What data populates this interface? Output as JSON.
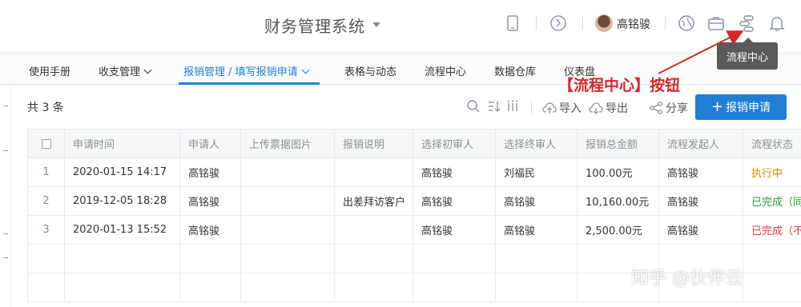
{
  "header": {
    "app_title": "财务管理系统",
    "username": "高铭骏"
  },
  "nav": {
    "items": [
      "使用手册",
      "收支管理",
      "报销管理 / 填写报销申请",
      "表格与动态",
      "流程中心",
      "数据仓库",
      "仪表盘"
    ],
    "active": "报销管理 / 填写报销申请"
  },
  "tooltip": "流程中心",
  "annotation": "【流程中心】按钮",
  "toolbar": {
    "count": "共 3 条",
    "import_label": "导入",
    "export_label": "导出",
    "share_label": "分享",
    "primary_label": "报销申请",
    "primary_prefix": "+"
  },
  "table": {
    "columns": [
      "申请时间",
      "申请人",
      "上传票据图片",
      "报销说明",
      "选择初审人",
      "选择终审人",
      "报销总金额",
      "流程发起人",
      "流程状态"
    ],
    "rows": [
      {
        "index": "1",
        "time": "2020-01-15 14:17",
        "applicant": "高铭骏",
        "image": "",
        "note": "",
        "first": "高铭骏",
        "final": "刘福民",
        "amount": "100.00元",
        "initiator": "高铭骏",
        "status": "执行中",
        "status_color": "#e08a00"
      },
      {
        "index": "2",
        "time": "2019-12-05 18:28",
        "applicant": "高铭骏",
        "image": "",
        "note": "出差拜访客户",
        "first": "高铭骏",
        "final": "高铭骏",
        "amount": "10,160.00元",
        "initiator": "高铭骏",
        "status": "已完成（同",
        "status_color": "#2e9e3e"
      },
      {
        "index": "3",
        "time": "2020-01-13 15:52",
        "applicant": "高铭骏",
        "image": "",
        "note": "",
        "first": "高铭骏",
        "final": "高铭骏",
        "amount": "2,500.00元",
        "initiator": "高铭骏",
        "status": "已完成（不",
        "status_color": "#e03a3a"
      }
    ]
  },
  "watermark": "知乎 @伙伴云",
  "colors": {
    "accent": "#1f7fd6",
    "annotation": "#d9262b"
  }
}
